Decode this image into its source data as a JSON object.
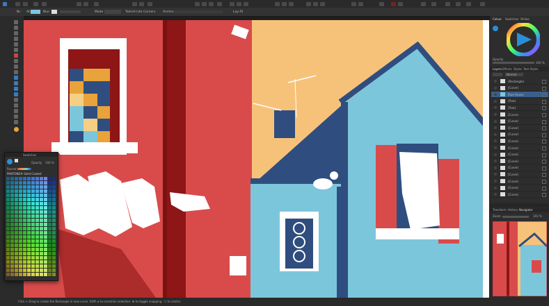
{
  "context_toolbar": {
    "mode_label": "Blend:",
    "labels": [
      "Nr.",
      "Ali.",
      "Blur",
      "Mode",
      "Tails",
      "Hi-Lite",
      "Corners",
      "Anchors",
      "Lay-Fil"
    ]
  },
  "right_panel": {
    "color_tabs": [
      "Colour",
      "Swatches",
      "Stroke"
    ],
    "layers_tabs": [
      "Layers",
      "Effects",
      "Styles",
      "Text Styles"
    ],
    "opacity_label": "Opacity",
    "opacity_value": "100 %",
    "blend_mode": "Normal",
    "layers": [
      {
        "name": "(Rectangle)",
        "selected": false
      },
      {
        "name": "(Curve)",
        "selected": false
      },
      {
        "name": "Blue House",
        "selected": true
      },
      {
        "name": "(Text)",
        "selected": false
      },
      {
        "name": "(Text)",
        "selected": false
      },
      {
        "name": "(Curve)",
        "selected": false
      },
      {
        "name": "(Curve)",
        "selected": false
      },
      {
        "name": "(Curve)",
        "selected": false
      },
      {
        "name": "(Curve)",
        "selected": false
      },
      {
        "name": "(Curve)",
        "selected": false
      },
      {
        "name": "(Curve)",
        "selected": false
      },
      {
        "name": "(Curve)",
        "selected": false
      },
      {
        "name": "(Curve)",
        "selected": false
      },
      {
        "name": "(Curve)",
        "selected": false
      },
      {
        "name": "(Curve)",
        "selected": false
      },
      {
        "name": "(Curve)",
        "selected": false
      },
      {
        "name": "(Curve)",
        "selected": false
      },
      {
        "name": "(Curve)",
        "selected": false
      }
    ],
    "bottom_tabs": [
      "Transform",
      "History",
      "Navigator"
    ],
    "zoom_label": "Zoom",
    "zoom_value": "103 %"
  },
  "swatches_panel": {
    "title": "Swatches",
    "opacity_label": "Opacity",
    "opacity_value": "100 %",
    "recent_label": "Recent",
    "palette_name": "PANTONE® Solid Coated"
  },
  "status": {
    "text": "Click + Drag to create the Rectangle in new curve. Shift ⊕ to constrain selection. ⌘ to toggle snapping. ⌥ to centre."
  },
  "colors": {
    "red": "#d94b4b",
    "dark_red": "#8e1616",
    "sky": "#f6c27a",
    "light_blue": "#7cc6dc",
    "navy": "#2f4e7f",
    "accent": "#2a8fd6"
  }
}
